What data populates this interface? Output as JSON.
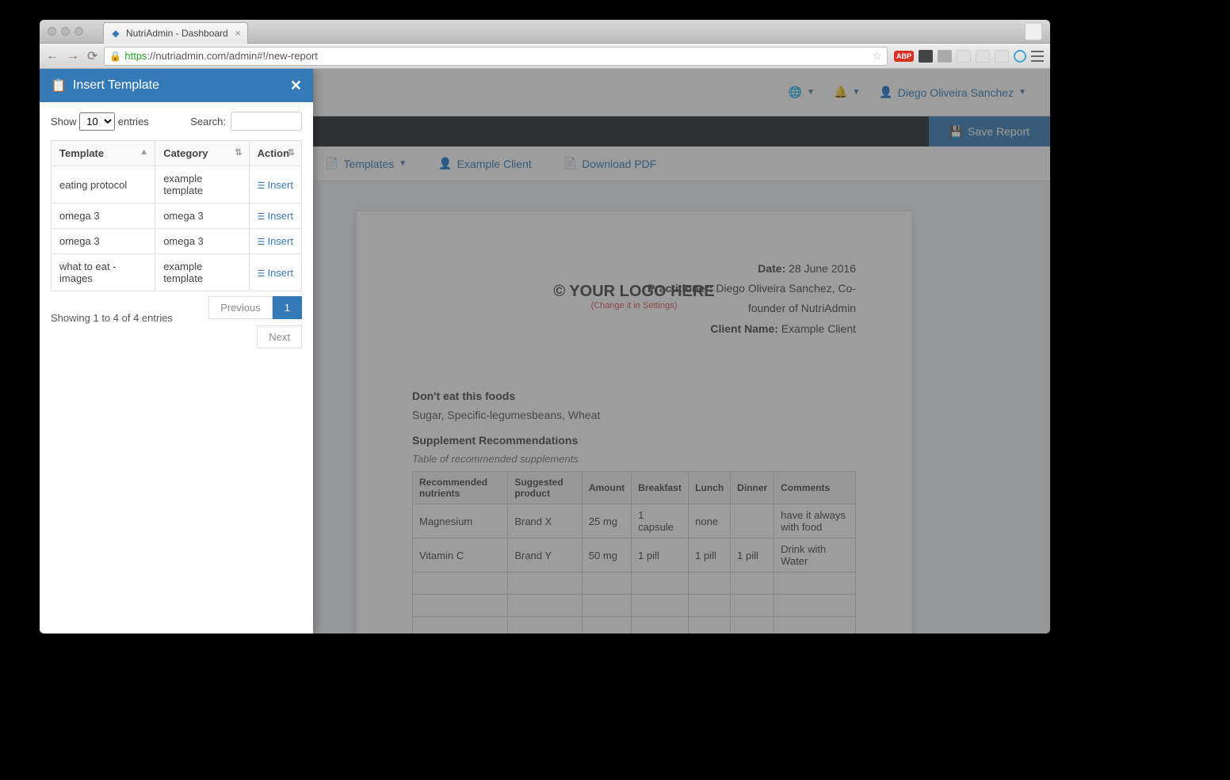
{
  "browser": {
    "tab_title": "NutriAdmin - Dashboard",
    "url_proto": "https",
    "url_rest": "://nutriadmin.com/admin#!/new-report"
  },
  "header": {
    "user_name": "Diego Oliveira Sanchez",
    "save_report": "Save Report"
  },
  "tabs": {
    "templates": "Templates",
    "example_client": "Example Client",
    "download_pdf": "Download PDF"
  },
  "report": {
    "logo_text": "© YOUR LOGO HERE",
    "logo_sub": "(Change it in Settings)",
    "date_label": "Date:",
    "date_value": "28 June 2016",
    "practitioner_label": "Practitioner:",
    "practitioner_value": "Diego Oliveira Sanchez, Co-founder of NutriAdmin",
    "client_label": "Client Name:",
    "client_value": "Example Client",
    "section1_title": "Don't eat this foods",
    "section1_body": "Sugar, Specific-legumesbeans, Wheat",
    "section2_title": "Supplement Recommendations",
    "section2_sub": "Table of recommended supplements",
    "supp_headers": [
      "Recommended nutrients",
      "Suggested product",
      "Amount",
      "Breakfast",
      "Lunch",
      "Dinner",
      "Comments"
    ],
    "supp_rows": [
      {
        "nutrient": "Magnesium",
        "product": "Brand X",
        "amount": "25 mg",
        "breakfast": "1 capsule",
        "lunch": "none",
        "dinner": "",
        "comments": "have it always with food"
      },
      {
        "nutrient": "Vitamin C",
        "product": "Brand Y",
        "amount": "50 mg",
        "breakfast": "1 pill",
        "lunch": "1 pill",
        "dinner": "1 pill",
        "comments": "Drink with Water"
      }
    ]
  },
  "modal": {
    "title": "Insert Template",
    "show_label": "Show",
    "entries_label": "entries",
    "show_value": "10",
    "search_label": "Search:",
    "col_template": "Template",
    "col_category": "Category",
    "col_action": "Action",
    "insert_label": "Insert",
    "rows": [
      {
        "template": "eating protocol",
        "category": "example template"
      },
      {
        "template": "omega 3",
        "category": "omega 3"
      },
      {
        "template": "omega 3",
        "category": "omega 3"
      },
      {
        "template": "what to eat - images",
        "category": "example template"
      }
    ],
    "info": "Showing 1 to 4 of 4 entries",
    "previous": "Previous",
    "page1": "1",
    "next": "Next"
  }
}
